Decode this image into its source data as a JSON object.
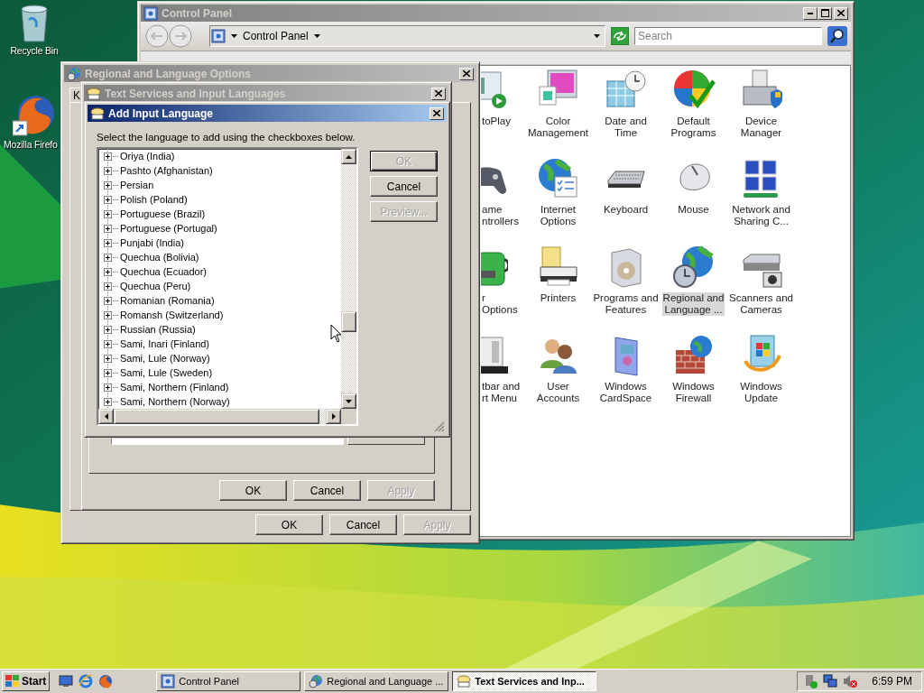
{
  "desktop_icons": [
    {
      "label": "Recycle Bin"
    },
    {
      "label": "Mozilla Firefo"
    }
  ],
  "control_panel": {
    "title": "Control Panel",
    "active": false,
    "address": "Control Panel",
    "search": {
      "placeholder": "Search"
    },
    "items": [
      {
        "label": "toPlay",
        "selected": false
      },
      {
        "label": "Color\nManagement",
        "selected": false
      },
      {
        "label": "Date and Time",
        "selected": false
      },
      {
        "label": "Default\nPrograms",
        "selected": false
      },
      {
        "label": "Device\nManager",
        "selected": false
      },
      {
        "label": "ame\nntrollers",
        "selected": false
      },
      {
        "label": "Internet\nOptions",
        "selected": false
      },
      {
        "label": "Keyboard",
        "selected": false
      },
      {
        "label": "Mouse",
        "selected": false
      },
      {
        "label": "Network and\nSharing C...",
        "selected": false
      },
      {
        "label": "r Options",
        "selected": false
      },
      {
        "label": "Printers",
        "selected": false
      },
      {
        "label": "Programs and\nFeatures",
        "selected": false
      },
      {
        "label": "Regional and\nLanguage ...",
        "selected": true
      },
      {
        "label": "Scanners and\nCameras",
        "selected": false
      },
      {
        "label": "tbar and\nrt Menu",
        "selected": false
      },
      {
        "label": "User Accounts",
        "selected": false
      },
      {
        "label": "Windows\nCardSpace",
        "selected": false
      },
      {
        "label": "Windows\nFirewall",
        "selected": false
      },
      {
        "label": "Windows\nUpdate",
        "selected": false
      }
    ]
  },
  "regional_dialog": {
    "title": "Regional and Language Options",
    "active": false,
    "tab": "K",
    "buttons": [
      {
        "label": "OK",
        "disabled": false
      },
      {
        "label": "Cancel",
        "disabled": false
      },
      {
        "label": "Apply",
        "disabled": true
      }
    ]
  },
  "text_services_dialog": {
    "title": "Text Services and Input Languages",
    "active": false,
    "buttons": [
      {
        "label": "OK",
        "disabled": false
      },
      {
        "label": "Cancel",
        "disabled": false
      },
      {
        "label": "Apply",
        "disabled": true
      }
    ]
  },
  "add_language_dialog": {
    "title": "Add Input Language",
    "active": true,
    "instruction": "Select the language to add using the checkboxes below.",
    "languages": [
      {
        "label": "Oriya (India)",
        "expanded": false
      },
      {
        "label": "Pashto (Afghanistan)",
        "expanded": false
      },
      {
        "label": "Persian",
        "expanded": false
      },
      {
        "label": "Polish (Poland)",
        "expanded": false
      },
      {
        "label": "Portuguese (Brazil)",
        "expanded": false
      },
      {
        "label": "Portuguese (Portugal)",
        "expanded": false
      },
      {
        "label": "Punjabi (India)",
        "expanded": false
      },
      {
        "label": "Quechua (Bolivia)",
        "expanded": false
      },
      {
        "label": "Quechua (Ecuador)",
        "expanded": false
      },
      {
        "label": "Quechua (Peru)",
        "expanded": false
      },
      {
        "label": "Romanian (Romania)",
        "expanded": false
      },
      {
        "label": "Romansh (Switzerland)",
        "expanded": false
      },
      {
        "label": "Russian (Russia)",
        "expanded": false
      },
      {
        "label": "Sami, Inari (Finland)",
        "expanded": false
      },
      {
        "label": "Sami, Lule (Norway)",
        "expanded": false
      },
      {
        "label": "Sami, Lule (Sweden)",
        "expanded": false
      },
      {
        "label": "Sami, Northern (Finland)",
        "expanded": false
      },
      {
        "label": "Sami, Northern (Norway)",
        "expanded": false
      }
    ],
    "buttons": [
      {
        "label": "OK",
        "disabled": true,
        "default": true
      },
      {
        "label": "Cancel",
        "disabled": false,
        "default": false
      },
      {
        "label": "Preview...",
        "disabled": true,
        "default": false
      }
    ]
  },
  "taskbar": {
    "start": "Start",
    "tasks": [
      {
        "label": "Control Panel",
        "selected": false
      },
      {
        "label": "Regional and Language ...",
        "selected": false
      },
      {
        "label": "Text Services and Inp...",
        "selected": true
      }
    ],
    "clock": "6:59 PM"
  }
}
